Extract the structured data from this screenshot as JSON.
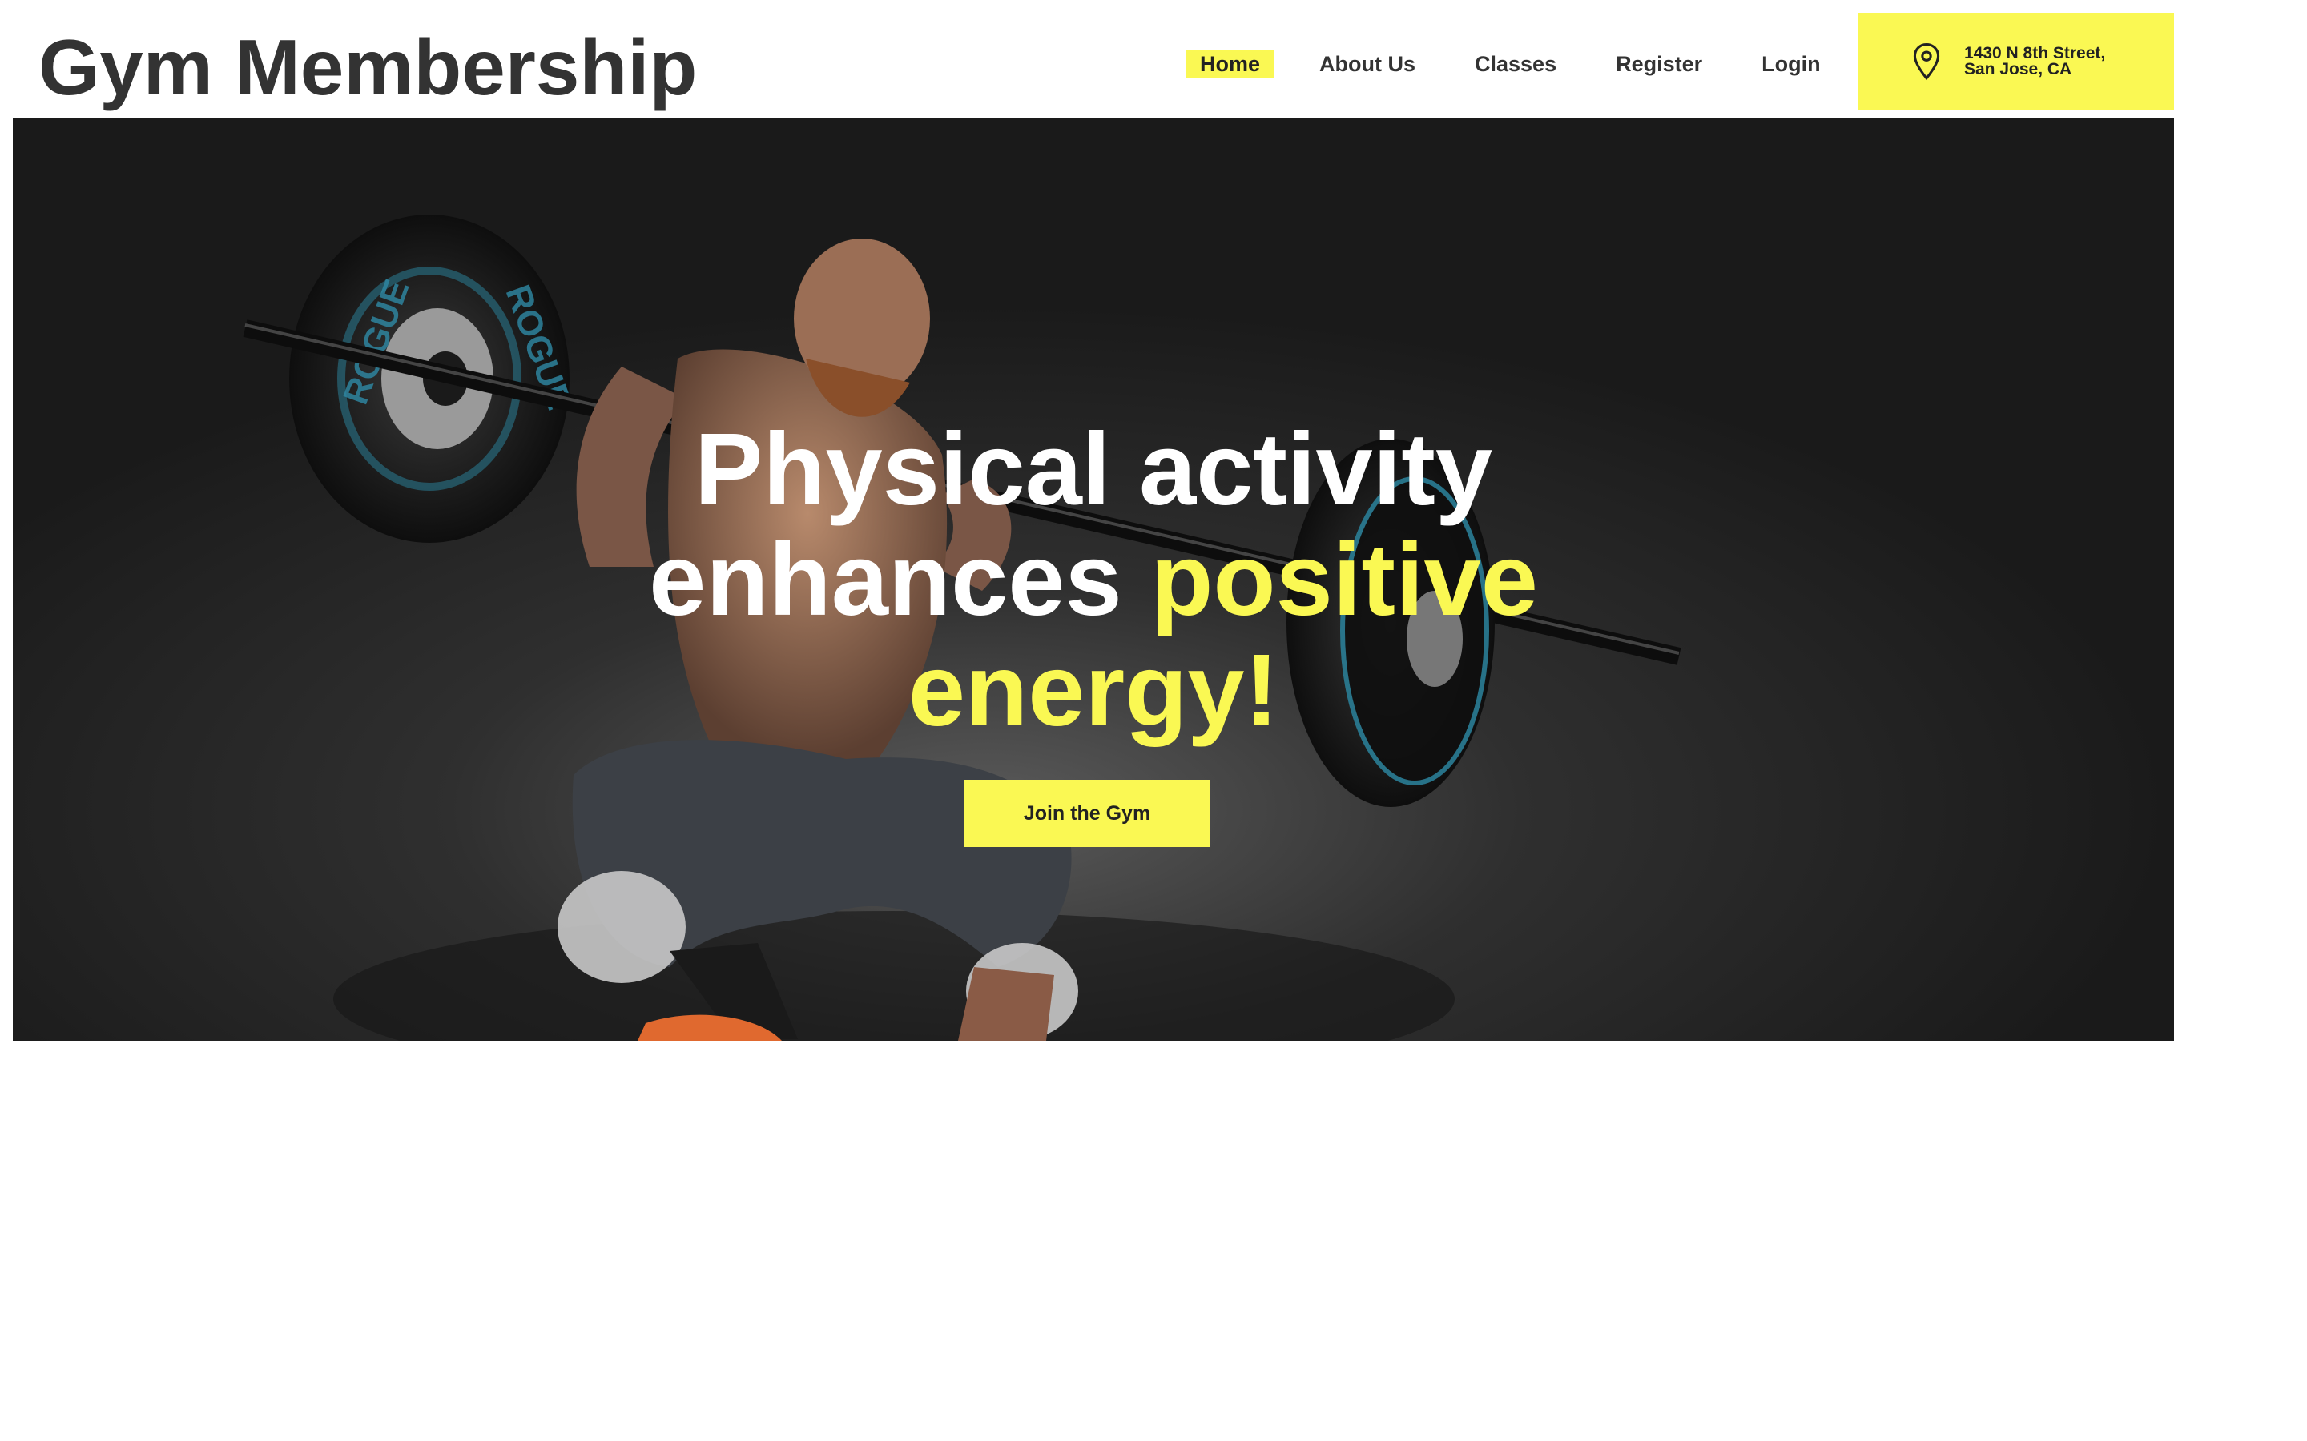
{
  "header": {
    "site_title": "Gym Membership",
    "nav": [
      {
        "label": "Home",
        "active": true
      },
      {
        "label": "About Us",
        "active": false
      },
      {
        "label": "Classes",
        "active": false
      },
      {
        "label": "Register",
        "active": false
      },
      {
        "label": "Login",
        "active": false
      }
    ],
    "address": {
      "icon": "map-pin-icon",
      "line1": "1430 N 8th Street,",
      "line2": "San Jose, CA"
    }
  },
  "hero": {
    "headline_white_1": "Physical activity",
    "headline_white_2": "enhances ",
    "headline_yellow_1": "positive",
    "headline_yellow_2": "energy!",
    "cta_label": "Join the Gym",
    "background": "photo of man squatting with barbell"
  },
  "colors": {
    "accent": "#faf853",
    "text_dark": "#333333",
    "hero_bg": "#1a1a1a"
  }
}
